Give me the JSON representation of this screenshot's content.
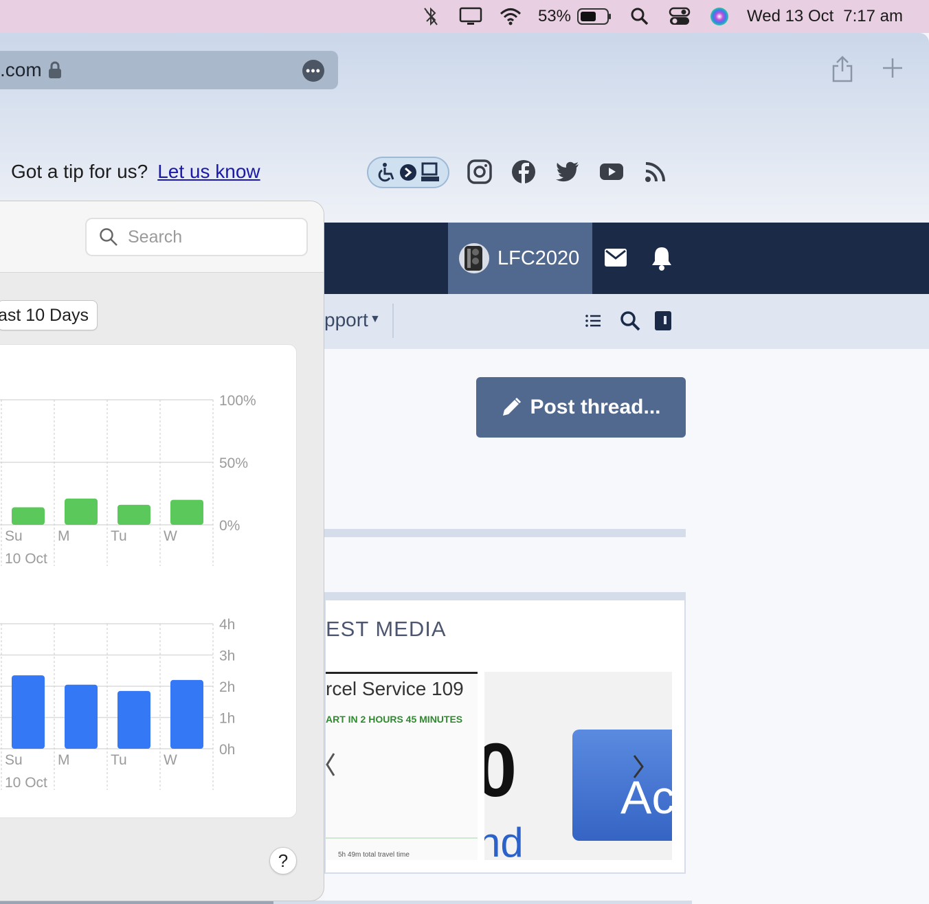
{
  "menubar": {
    "battery_percent": "53%",
    "date": "Wed 13 Oct",
    "time": "7:17 am",
    "icons": [
      "bluetooth-icon",
      "display-icon",
      "wifi-icon",
      "battery-icon",
      "spotlight-icon",
      "control-center-icon",
      "siri-icon"
    ]
  },
  "browser": {
    "url_fragment": ".com",
    "tip_text": "Got a tip for us?",
    "tip_link": "Let us know"
  },
  "site_nav": {
    "username": "LFC2020",
    "subnav_label": "pport"
  },
  "content": {
    "post_button": "Post thread...",
    "media_title": "EST MEDIA",
    "thumb1_title": "rcel Service 109",
    "thumb1_subtitle": "ART IN 2 HOURS 45 MINUTES",
    "thumb1_footer": "5h 49m total travel time",
    "thumb2_big": "0",
    "thumb2_bottom": "nd",
    "thumb2_tile": "Ac"
  },
  "screen_time": {
    "search_placeholder": "Search",
    "range_label": "ast 10 Days",
    "help_label": "?"
  },
  "chart_data": [
    {
      "type": "bar",
      "categories": [
        "Su",
        "M",
        "Tu",
        "W"
      ],
      "x_sublabel": "10 Oct",
      "values": [
        14,
        21,
        16,
        20
      ],
      "y_ticks": [
        "100%",
        "50%",
        "0%"
      ],
      "ylim": [
        0,
        100
      ],
      "color": "#5ac85a",
      "grid": true
    },
    {
      "type": "bar",
      "categories": [
        "Su",
        "M",
        "Tu",
        "W"
      ],
      "x_sublabel": "10 Oct",
      "values": [
        2.35,
        2.05,
        1.85,
        2.2
      ],
      "y_ticks": [
        "4h",
        "3h",
        "2h",
        "1h",
        "0h"
      ],
      "ylim": [
        0,
        4
      ],
      "color": "#3478f6",
      "grid": true
    }
  ]
}
